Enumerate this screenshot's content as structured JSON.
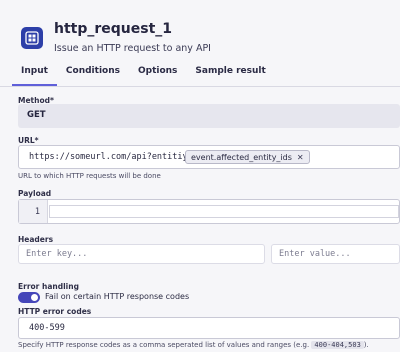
{
  "header": {
    "title": "http_request_1",
    "subtitle": "Issue an HTTP request to any API",
    "icon": "http-request-icon",
    "icon_bg": "#2d3fa8"
  },
  "tabs": [
    {
      "label": "Input",
      "active": true
    },
    {
      "label": "Conditions",
      "active": false
    },
    {
      "label": "Options",
      "active": false
    },
    {
      "label": "Sample result",
      "active": false
    }
  ],
  "method": {
    "label": "Method*",
    "value": "GET"
  },
  "url": {
    "label": "URL*",
    "text": "https://someurl.com/api?entitiy=",
    "chip": "event.affected_entity_ids",
    "hint": "URL to which HTTP requests will be done"
  },
  "payload": {
    "label": "Payload",
    "line_number": "1"
  },
  "headers": {
    "label": "Headers",
    "key_placeholder": "Enter key...",
    "value_placeholder": "Enter value..."
  },
  "error_handling": {
    "label": "Error handling",
    "toggle_label": "Fail on certain HTTP response codes",
    "toggle_on": true,
    "codes_label": "HTTP error codes",
    "codes_value": "400-599",
    "hint_prefix": "Specify HTTP response codes as a comma seperated list of values and ranges (e.g.",
    "hint_example": "400-404,503",
    "hint_suffix": ")."
  },
  "colors": {
    "accent": "#5f5fd9",
    "toggle": "#4546b9"
  }
}
